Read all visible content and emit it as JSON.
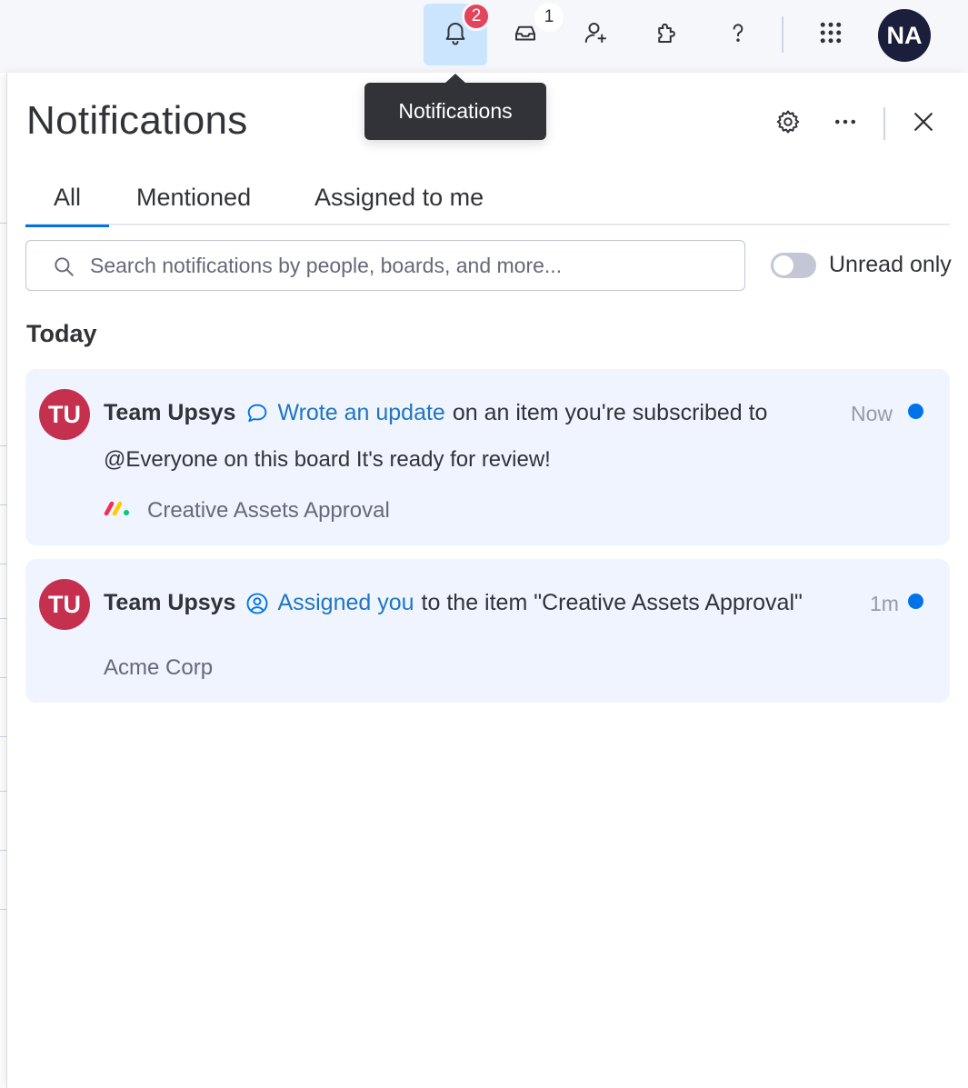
{
  "topbar": {
    "notifications_badge": "2",
    "inbox_badge": "1",
    "avatar_initials": "NA",
    "icons": [
      "bell-icon",
      "inbox-icon",
      "invite-user-icon",
      "puzzle-icon",
      "help-icon",
      "apps-grid-icon"
    ]
  },
  "tooltip": {
    "text": "Notifications"
  },
  "panel": {
    "title": "Notifications",
    "tabs": [
      {
        "label": "All",
        "active": true
      },
      {
        "label": "Mentioned",
        "active": false
      },
      {
        "label": "Assigned to me",
        "active": false
      }
    ],
    "search": {
      "placeholder": "Search notifications by people, boards, and more...",
      "value": ""
    },
    "unread_toggle": {
      "label": "Unread only",
      "on": false
    },
    "section_today": "Today"
  },
  "notifications": [
    {
      "avatar": "TU",
      "author": "Team Upsys",
      "action_icon": "comment-icon",
      "action": "Wrote an update",
      "rest": "on an item you're subscribed to",
      "time": "Now",
      "unread": true,
      "body": "@Everyone on this board It's ready for review!",
      "board": "Creative Assets Approval"
    },
    {
      "avatar": "TU",
      "author": "Team Upsys",
      "action_icon": "user-circle-icon",
      "action": "Assigned you",
      "rest": "to the item \"Creative Assets Approval\"",
      "time": "1m",
      "unread": true,
      "board": "Acme Corp"
    }
  ],
  "colors": {
    "accent": "#0073ea",
    "avatar_tu": "#c5304f",
    "badge_red": "#e2445c",
    "card_bg": "#f0f4fe",
    "tooltip_bg": "#323338"
  }
}
